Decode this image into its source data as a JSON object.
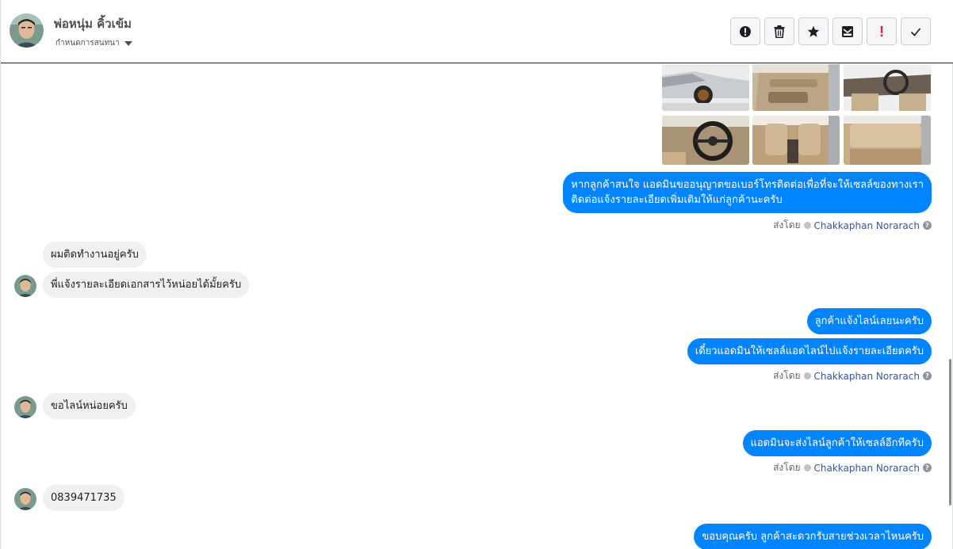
{
  "header": {
    "contact_name": "พ่อหนุ่ม คิ้วเข้ม",
    "assign_label": "กำหนดการสนทนา",
    "actions": [
      {
        "name": "report-spam",
        "icon": "alert-circle-icon",
        "label": ""
      },
      {
        "name": "delete",
        "icon": "trash-icon",
        "label": ""
      },
      {
        "name": "star",
        "icon": "star-icon",
        "label": ""
      },
      {
        "name": "mark-unread",
        "icon": "envelope-icon",
        "label": ""
      },
      {
        "name": "follow-up",
        "icon": "exclamation-icon",
        "label": "!"
      },
      {
        "name": "mark-done",
        "icon": "checkmark-icon",
        "label": ""
      }
    ]
  },
  "colors": {
    "outgoing_bubble": "#0084ff",
    "incoming_bubble": "#f1f0f0",
    "link": "#385898",
    "follow_up_red": "#e41e3f"
  },
  "thread": {
    "photos": [
      {
        "name": "car-exterior-front-side"
      },
      {
        "name": "car-door-panel"
      },
      {
        "name": "car-interior-dashboard"
      },
      {
        "name": "car-steering-wheel"
      },
      {
        "name": "car-front-seats"
      },
      {
        "name": "car-rear-seat"
      }
    ],
    "messages": [
      {
        "direction": "out",
        "lines": [
          "หากลูกค้าสนใจ แอดมินขออนุญาตขอเบอร์โทรติดต่อเพื่อที่จะให้เซลล์ของทางเรา",
          "ติดต่อแจ้งรายละเอียดเพิ่มเติมให้แก่ลูกค้านะครับ"
        ]
      },
      {
        "direction": "in",
        "text": "ผมติดทำงานอยู่ครับ"
      },
      {
        "direction": "in",
        "text": "พี่แจ้งรายละเอียดเอกสารไว้หน่อยได้มั้ยครับ"
      },
      {
        "direction": "out",
        "text": "ลูกค้าแจ้งไลน์เลยนะครับ"
      },
      {
        "direction": "out",
        "text": "เดี๋ยวแอดมินให้เซลล์แอดไลน์ไปแจ้งรายละเอียดครับ"
      },
      {
        "direction": "in",
        "text": "ขอไลน์หน่อยครับ"
      },
      {
        "direction": "out",
        "text": "แอดมินจะส่งไลน์ลูกค้าให้เซลล์อีกทีครับ"
      },
      {
        "direction": "in",
        "text": "0839471735"
      },
      {
        "direction": "out",
        "text": "ขอบคุณครับ ลูกค้าสะดวกรับสายช่วงเวลาไหนครับ"
      }
    ],
    "sent_by": {
      "prefix": "ส่งโดย",
      "agent": "Chakkaphan Norarach",
      "help_glyph": "?"
    }
  }
}
